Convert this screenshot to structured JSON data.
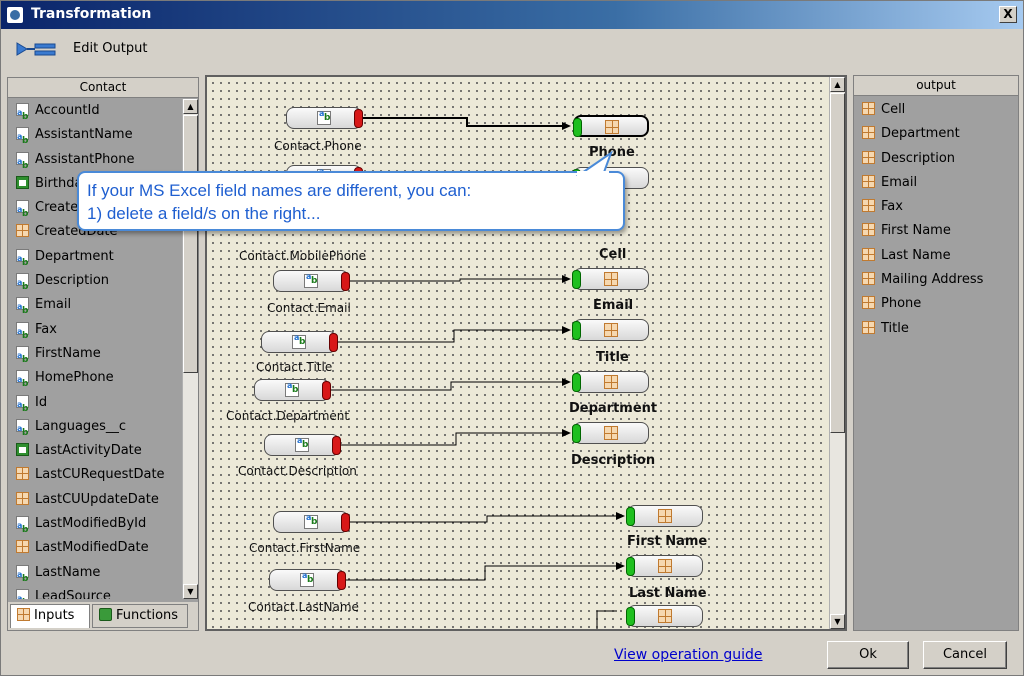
{
  "window": {
    "title": "Transformation",
    "close_label": "X"
  },
  "toolbar": {
    "edit_output_label": "Edit Output"
  },
  "left_panel": {
    "header": "Contact",
    "fields": [
      {
        "label": "AccountId",
        "icon": "text-field-icon"
      },
      {
        "label": "AssistantName",
        "icon": "text-field-icon"
      },
      {
        "label": "AssistantPhone",
        "icon": "text-field-icon"
      },
      {
        "label": "Birthda",
        "icon": "date-field-icon"
      },
      {
        "label": "Create",
        "icon": "text-field-icon"
      },
      {
        "label": "CreatedDate",
        "icon": "grid-field-icon"
      },
      {
        "label": "Department",
        "icon": "text-field-icon"
      },
      {
        "label": "Description",
        "icon": "text-field-icon"
      },
      {
        "label": "Email",
        "icon": "text-field-icon"
      },
      {
        "label": "Fax",
        "icon": "text-field-icon"
      },
      {
        "label": "FirstName",
        "icon": "text-field-icon"
      },
      {
        "label": "HomePhone",
        "icon": "text-field-icon"
      },
      {
        "label": "Id",
        "icon": "text-field-icon"
      },
      {
        "label": "Languages__c",
        "icon": "text-field-icon"
      },
      {
        "label": "LastActivityDate",
        "icon": "date-field-icon"
      },
      {
        "label": "LastCURequestDate",
        "icon": "grid-field-icon"
      },
      {
        "label": "LastCUUpdateDate",
        "icon": "grid-field-icon"
      },
      {
        "label": "LastModifiedById",
        "icon": "text-field-icon"
      },
      {
        "label": "LastModifiedDate",
        "icon": "grid-field-icon"
      },
      {
        "label": "LastName",
        "icon": "text-field-icon"
      },
      {
        "label": "LeadSource",
        "icon": "text-field-icon"
      }
    ],
    "tabs": {
      "inputs": "Inputs",
      "functions": "Functions"
    }
  },
  "canvas": {
    "sources": [
      {
        "label": "Contact.Phone"
      },
      {
        "label": "Contact.MobilePhone"
      },
      {
        "label": "Contact.Email"
      },
      {
        "label": "Contact.Title"
      },
      {
        "label": "Contact.Department"
      },
      {
        "label": "Contact.Description"
      },
      {
        "label": "Contact.FirstName"
      },
      {
        "label": "Contact.LastName"
      }
    ],
    "targets": [
      {
        "label": "Phone"
      },
      {
        "label": "Cell"
      },
      {
        "label": "Email"
      },
      {
        "label": "Title"
      },
      {
        "label": "Department"
      },
      {
        "label": "Description"
      },
      {
        "label": "First Name"
      },
      {
        "label": "Last Name"
      }
    ]
  },
  "callout": {
    "line1": "If your MS Excel field names are different, you can:",
    "line2": "1) delete a field/s on the right..."
  },
  "right_panel": {
    "header": "output",
    "fields": [
      "Cell",
      "Department",
      "Description",
      "Email",
      "Fax",
      "First Name",
      "Last Name",
      "Mailing Address",
      "Phone",
      "Title"
    ]
  },
  "bottom": {
    "guide_link": "View operation guide",
    "ok_label": "Ok",
    "cancel_label": "Cancel"
  }
}
